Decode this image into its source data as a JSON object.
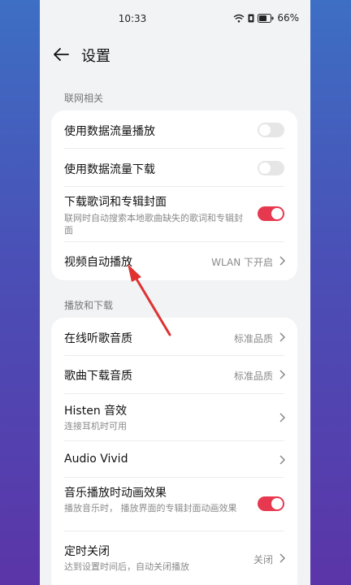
{
  "status_bar": {
    "time": "10:33",
    "battery": "66%"
  },
  "header": {
    "title": "设置"
  },
  "sections": [
    {
      "label": "联网相关",
      "rows": [
        {
          "title": "使用数据流量播放",
          "toggle": "off"
        },
        {
          "title": "使用数据流量下载",
          "toggle": "off"
        },
        {
          "title": "下载歌词和专辑封面",
          "subtitle": "联网时自动搜索本地歌曲缺失的歌词和专辑封面",
          "toggle": "on"
        },
        {
          "title": "视频自动播放",
          "value": "WLAN 下开启"
        }
      ]
    },
    {
      "label": "播放和下载",
      "rows": [
        {
          "title": "在线听歌音质",
          "value": "标准品质"
        },
        {
          "title": "歌曲下载音质",
          "value": "标准品质"
        },
        {
          "title": "Histen 音效",
          "subtitle": "连接耳机时可用"
        },
        {
          "title": "Audio Vivid"
        },
        {
          "title": "音乐播放时动画效果",
          "subtitle": "播放音乐时， 播放界面的专辑封面动画效果",
          "toggle": "on"
        },
        {
          "title": "定时关闭",
          "subtitle": "达到设置时间后，自动关闭播放",
          "value": "关闭"
        }
      ]
    }
  ],
  "colors": {
    "accent": "#e63950",
    "annotation_arrow": "#e03131"
  }
}
